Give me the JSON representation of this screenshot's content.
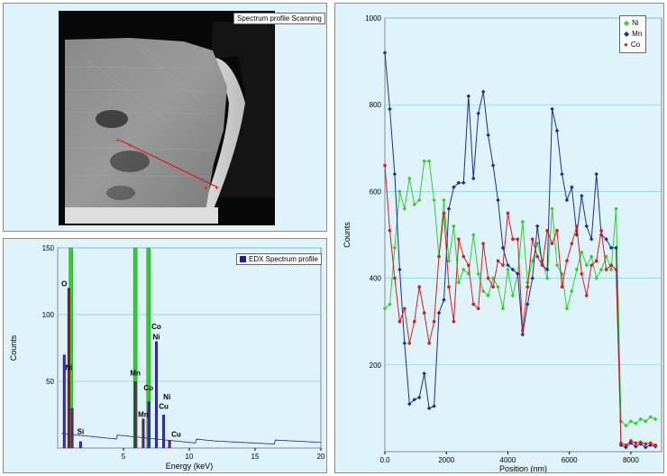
{
  "image_panel": {
    "label": "Spectrum profile Scanning"
  },
  "edx_panel": {
    "legend": "EDX Spectrum profile",
    "legend_color": "#1f1f8f"
  },
  "colors": {
    "plot_bg": "#dff3fb",
    "grid": "#7fd0e0",
    "Ni": "#33cc33",
    "Mn": "#1c2f8f",
    "Co": "#cc2222",
    "edx_bar": "#1f1f8f",
    "edx_line": "#cc2222",
    "edx_peak": "#33cc33"
  },
  "chart_data": [
    {
      "type": "bar",
      "legend": [
        "EDX Spectrum profile"
      ],
      "xlabel": "Energy (keV)",
      "ylabel": "Counts",
      "xlim": [
        0,
        20
      ],
      "ylim": [
        0,
        150
      ],
      "xticks": [
        "5",
        "10",
        "15",
        "20"
      ],
      "yticks": [
        "50",
        "100",
        "150"
      ],
      "grid": true,
      "peaks": [
        {
          "x": 0.5,
          "y": 70
        },
        {
          "x": 0.85,
          "y": 120
        },
        {
          "x": 1.1,
          "y": 30
        },
        {
          "x": 1.74,
          "y": 5
        },
        {
          "x": 5.9,
          "y": 50
        },
        {
          "x": 6.5,
          "y": 22
        },
        {
          "x": 6.93,
          "y": 35
        },
        {
          "x": 7.5,
          "y": 80
        },
        {
          "x": 8.05,
          "y": 25
        },
        {
          "x": 8.5,
          "y": 6
        }
      ],
      "green_peaks": [
        1.0,
        5.9,
        6.9
      ],
      "annotations": [
        {
          "text": "O",
          "x": 0.5,
          "y": 120
        },
        {
          "text": "Ni",
          "x": 0.85,
          "y": 57
        },
        {
          "text": "Si",
          "x": 1.74,
          "y": 9
        },
        {
          "text": "Mn",
          "x": 5.9,
          "y": 53
        },
        {
          "text": "Co",
          "x": 6.9,
          "y": 42
        },
        {
          "text": "Mn",
          "x": 6.5,
          "y": 22
        },
        {
          "text": "Co",
          "x": 7.5,
          "y": 88
        },
        {
          "text": "Ni",
          "x": 7.5,
          "y": 80
        },
        {
          "text": "Ni",
          "x": 8.3,
          "y": 35
        },
        {
          "text": "Cu",
          "x": 8.05,
          "y": 28
        },
        {
          "text": "Cu",
          "x": 9.0,
          "y": 7
        }
      ]
    },
    {
      "type": "line",
      "xlabel": "Position (nm)",
      "ylabel": "Counts",
      "xlim": [
        0,
        9000
      ],
      "ylim": [
        0,
        1000
      ],
      "xticks": [
        "0.0",
        "2000",
        "4000",
        "6000",
        "8000"
      ],
      "yticks": [
        "200",
        "400",
        "600",
        "800",
        "1000"
      ],
      "grid": true,
      "legend_position": "top-right",
      "series": [
        {
          "name": "Ni",
          "x": [
            0,
            160,
            320,
            480,
            640,
            800,
            960,
            1120,
            1280,
            1440,
            1600,
            1760,
            1920,
            2080,
            2240,
            2400,
            2560,
            2720,
            2880,
            3040,
            3200,
            3360,
            3520,
            3680,
            3840,
            4000,
            4160,
            4320,
            4480,
            4640,
            4800,
            4960,
            5120,
            5280,
            5440,
            5600,
            5760,
            5920,
            6080,
            6240,
            6400,
            6560,
            6720,
            6880,
            7040,
            7200,
            7360,
            7520,
            7680,
            7840,
            8000,
            8160,
            8320,
            8480,
            8640,
            8800
          ],
          "y": [
            330,
            340,
            470,
            600,
            560,
            630,
            570,
            580,
            670,
            670,
            580,
            450,
            580,
            440,
            520,
            390,
            420,
            410,
            500,
            410,
            370,
            360,
            400,
            380,
            330,
            420,
            360,
            410,
            530,
            390,
            440,
            480,
            440,
            400,
            560,
            430,
            410,
            330,
            370,
            420,
            460,
            430,
            450,
            400,
            420,
            450,
            420,
            560,
            70,
            60,
            70,
            65,
            75,
            70,
            80,
            75
          ]
        },
        {
          "name": "Mn",
          "x": [
            0,
            160,
            320,
            480,
            640,
            800,
            960,
            1120,
            1280,
            1440,
            1600,
            1760,
            1920,
            2080,
            2240,
            2400,
            2560,
            2720,
            2880,
            3040,
            3200,
            3360,
            3520,
            3680,
            3840,
            4000,
            4160,
            4320,
            4480,
            4640,
            4800,
            4960,
            5120,
            5280,
            5440,
            5600,
            5760,
            5920,
            6080,
            6240,
            6400,
            6560,
            6720,
            6880,
            7040,
            7200,
            7360,
            7520,
            7680,
            7840,
            8000,
            8160,
            8320,
            8480,
            8640,
            8800
          ],
          "y": [
            920,
            790,
            640,
            420,
            250,
            110,
            120,
            125,
            180,
            100,
            105,
            320,
            350,
            560,
            610,
            620,
            620,
            820,
            630,
            780,
            830,
            730,
            660,
            580,
            470,
            430,
            420,
            410,
            270,
            340,
            400,
            520,
            430,
            420,
            790,
            740,
            640,
            580,
            610,
            500,
            590,
            520,
            490,
            640,
            500,
            490,
            470,
            470,
            15,
            10,
            20,
            12,
            18,
            10,
            15,
            12
          ]
        },
        {
          "name": "Co",
          "x": [
            0,
            160,
            320,
            480,
            640,
            800,
            960,
            1120,
            1280,
            1440,
            1600,
            1760,
            1920,
            2080,
            2240,
            2400,
            2560,
            2720,
            2880,
            3040,
            3200,
            3360,
            3520,
            3680,
            3840,
            4000,
            4160,
            4320,
            4480,
            4640,
            4800,
            4960,
            5120,
            5280,
            5440,
            5600,
            5760,
            5920,
            6080,
            6240,
            6400,
            6560,
            6720,
            6880,
            7040,
            7200,
            7360,
            7520,
            7680,
            7840,
            8000,
            8160,
            8320,
            8480,
            8640,
            8800
          ],
          "y": [
            660,
            510,
            400,
            300,
            330,
            250,
            300,
            380,
            320,
            250,
            300,
            450,
            550,
            380,
            300,
            490,
            450,
            430,
            340,
            330,
            480,
            400,
            380,
            440,
            430,
            550,
            490,
            490,
            280,
            380,
            490,
            450,
            430,
            510,
            480,
            510,
            380,
            440,
            480,
            520,
            410,
            360,
            430,
            440,
            510,
            420,
            430,
            420,
            20,
            15,
            25,
            20,
            22,
            18,
            20,
            15
          ]
        }
      ]
    }
  ]
}
